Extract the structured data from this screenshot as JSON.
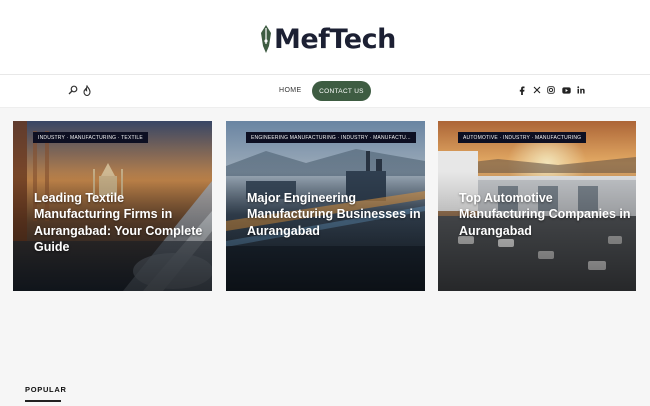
{
  "brand": {
    "name": "MefTech"
  },
  "nav": {
    "home": "HOME",
    "contact": "CONTACT US",
    "left_icons": [
      "search-icon",
      "flame-icon"
    ],
    "social": [
      "facebook-icon",
      "x-icon",
      "instagram-icon",
      "youtube-icon",
      "linkedin-icon"
    ],
    "accent": "#3e5c42"
  },
  "cards": [
    {
      "category": "INDUSTRY · MANUFACTURING · TEXTILE",
      "title": "Leading Textile Manufacturing Firms in Aurangabad: Your Complete Guide"
    },
    {
      "category": "ENGINEERING MANUFACTURING · INDUSTRY · MANUFACTU...",
      "title": "Major Engineering Manufacturing Businesses in Aurangabad"
    },
    {
      "category": "AUTOMOTIVE · INDUSTRY · MANUFACTURING",
      "title": "Top Automotive Manufacturing Companies in Aurangabad"
    }
  ],
  "sections": {
    "popular": "POPULAR"
  }
}
